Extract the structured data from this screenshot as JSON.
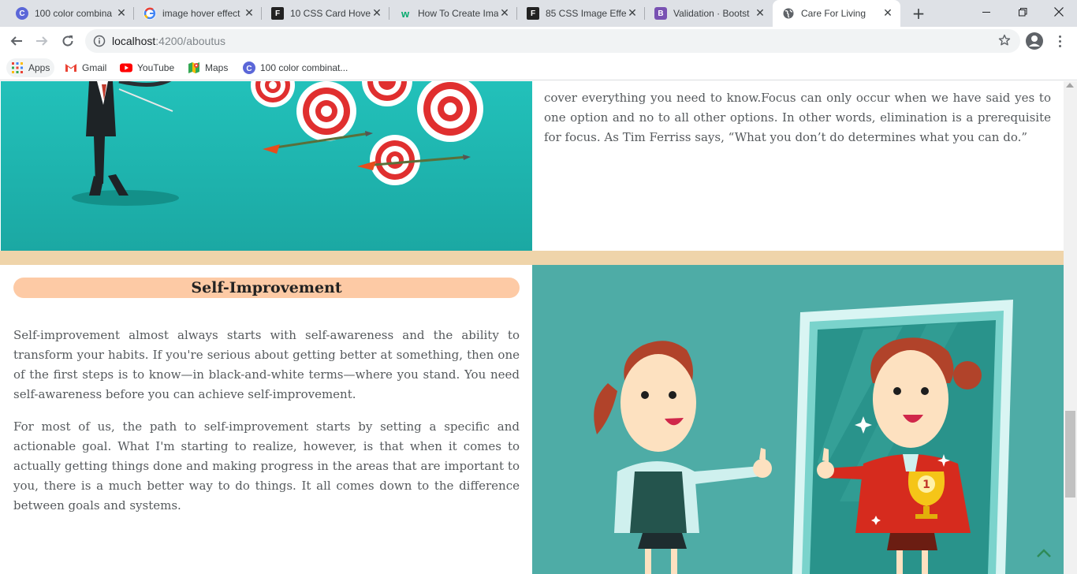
{
  "browser": {
    "tabs": [
      {
        "title": "100 color combina",
        "icon": "canva-icon",
        "favicon_letter": "C",
        "color": "#5b67d8"
      },
      {
        "title": "image hover effect",
        "icon": "google-icon",
        "favicon_letter": "G",
        "color": "#4285f4"
      },
      {
        "title": "10 CSS Card Hover",
        "icon": "freefrontend-icon",
        "favicon_letter": "F",
        "color": "#222222"
      },
      {
        "title": "How To Create Ima",
        "icon": "w3schools-icon",
        "favicon_letter": "w",
        "color": "#04aa6d"
      },
      {
        "title": "85 CSS Image Effe",
        "icon": "freefrontend-icon",
        "favicon_letter": "F",
        "color": "#222222"
      },
      {
        "title": "Validation · Bootst",
        "icon": "bootstrap-icon",
        "favicon_letter": "B",
        "color": "#7952b3"
      },
      {
        "title": "Care For Living",
        "icon": "globe-icon",
        "favicon_letter": "",
        "color": "#5f6368"
      }
    ],
    "address": {
      "host": "localhost",
      "rest": ":4200/aboutus"
    },
    "bookmarks": [
      {
        "label": "Apps",
        "icon": "apps-grid-icon"
      },
      {
        "label": "Gmail",
        "icon": "gmail-icon"
      },
      {
        "label": "YouTube",
        "icon": "youtube-icon"
      },
      {
        "label": "Maps",
        "icon": "maps-icon"
      },
      {
        "label": "100 color combinat...",
        "icon": "canva-icon"
      }
    ]
  },
  "page": {
    "focus_text": "cover everything you need to know.Focus can only occur when we have said yes to one option and no to all other options. In other words, elimination is a prerequisite for focus. As Tim Ferriss says, “What you don’t do determines what you can do.”",
    "self_improvement": {
      "heading": "Self-Improvement",
      "paragraph1": "Self-improvement almost always starts with self-awareness and the ability to transform your habits. If you're serious about getting better at something, then one of the first steps is to know—in black-and-white terms—where you stand. You need self-awareness before you can achieve self-improvement.",
      "paragraph2": "For most of us, the path to self-improvement starts by setting a specific and actionable goal. What I'm starting to realize, however, is that when it comes to actually getting things done and making progress in the areas that are important to you, there is a much better way to do things. It all comes down to the difference between goals and systems."
    },
    "colors": {
      "divider": "#efd4aa",
      "heading_pill": "#fdcaa5",
      "teal": "#4eaca6",
      "body_text": "#55595c"
    }
  }
}
